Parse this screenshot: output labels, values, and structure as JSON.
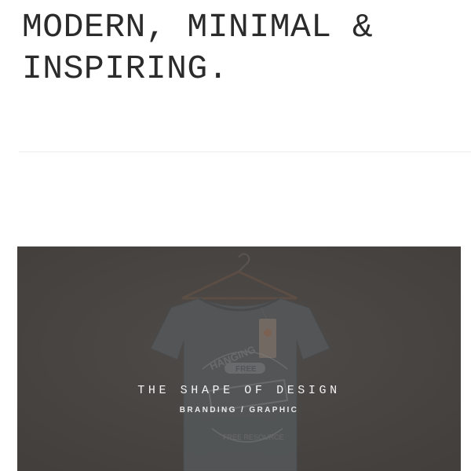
{
  "hero": {
    "line1": "MODERN, MINIMAL &",
    "line2": "INSPIRING."
  },
  "card": {
    "title": "THE SHAPE OF DESIGN",
    "subtitle": "BRANDING / GRAPHIC",
    "tshirt_print": {
      "arc_text": "HANGING",
      "badge_text": "FREE",
      "banner_text": "SHIRT",
      "bottom_arc_text": "FREE RESOURCE"
    },
    "image_icon": "tshirt-on-hanger-mockup",
    "overlay_color": "#4a4644"
  }
}
